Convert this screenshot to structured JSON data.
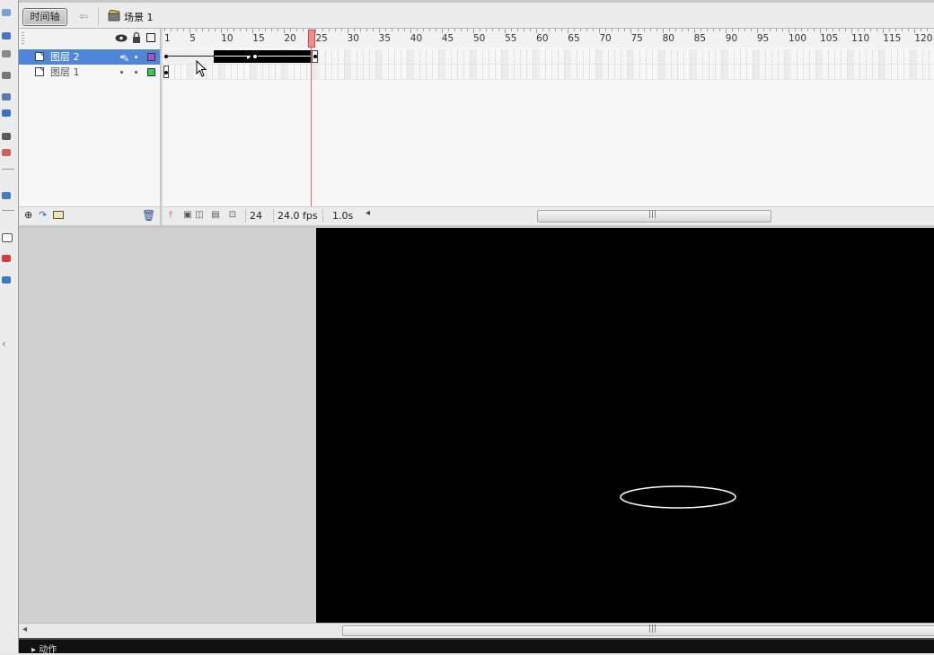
{
  "topbar": {
    "timeline_button": "时间轴",
    "back_icon": "arrow-left-icon",
    "scene_icon": "clapperboard-icon",
    "scene_label": "场景 1"
  },
  "layer_header": {
    "eye_icon": "eye-icon",
    "lock_icon": "lock-icon",
    "outline_icon": "outline-square-icon"
  },
  "layers": [
    {
      "name": "图层 2",
      "selected": true,
      "color": "#9b59d0"
    },
    {
      "name": "图层 1",
      "selected": false,
      "color": "#33cc55"
    }
  ],
  "ruler": {
    "labels": [
      "1",
      "5",
      "10",
      "15",
      "20",
      "25",
      "30",
      "35",
      "40",
      "45",
      "50",
      "55",
      "60",
      "65",
      "70",
      "75",
      "80",
      "85",
      "90",
      "95",
      "100",
      "105",
      "110",
      "115",
      "120"
    ]
  },
  "playhead": {
    "frame": 24
  },
  "status": {
    "current_frame": "24",
    "frame_rate": "24.0 fps",
    "elapsed": "1.0s"
  },
  "actions_panel": {
    "label": "▸ 动作"
  },
  "colors": {
    "stage": "#000000",
    "selection": "#4f86d8",
    "playhead": "#f58a8a",
    "ellipse_stroke": "#ffffff"
  }
}
